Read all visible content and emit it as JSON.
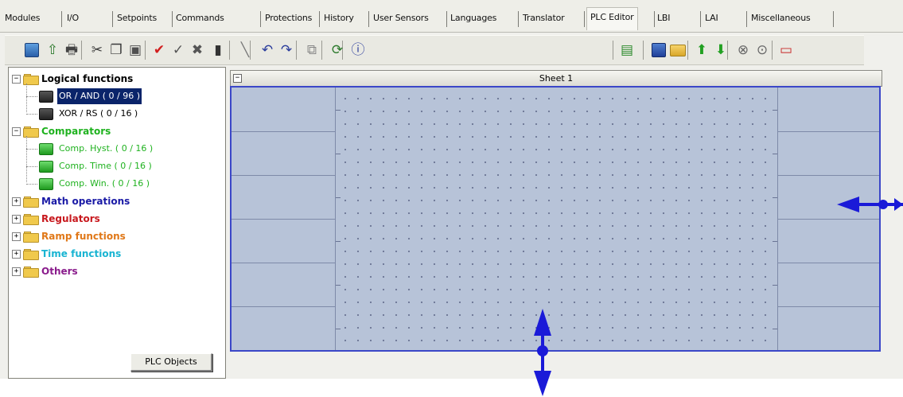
{
  "tabs": [
    {
      "label": "Modules",
      "active": false
    },
    {
      "label": "I/O",
      "active": false
    },
    {
      "label": "Setpoints",
      "active": false
    },
    {
      "label": "Commands",
      "active": false
    },
    {
      "label": "Protections",
      "active": false
    },
    {
      "label": "History",
      "active": false
    },
    {
      "label": "User Sensors",
      "active": false
    },
    {
      "label": "Languages",
      "active": false
    },
    {
      "label": "Translator",
      "active": false
    },
    {
      "label": "PLC Editor",
      "active": true
    },
    {
      "label": "LBI",
      "active": false
    },
    {
      "label": "LAI",
      "active": false
    },
    {
      "label": "Miscellaneous",
      "active": false
    }
  ],
  "toolbar": {
    "left_icons": [
      "save-icon",
      "upload-icon",
      "print-icon",
      "cut-icon",
      "copy-icon",
      "paste-icon",
      "check-red-icon",
      "check-icon",
      "delete-x-icon",
      "trash-icon",
      "line-tool-icon",
      "undo-icon",
      "redo-icon",
      "duplicate-icon",
      "refresh-doc-icon",
      "info-icon"
    ],
    "right_icons": [
      "new-sheet-icon",
      "save-disk-icon",
      "open-folder-icon",
      "move-up-icon",
      "move-down-icon",
      "collapse-all-icon",
      "expand-all-icon",
      "window-icon"
    ]
  },
  "tree": {
    "categories": [
      {
        "label": "Logical functions",
        "color": "#000000",
        "expanded": true,
        "items": [
          {
            "label": "OR / AND ( 0 / 96 )",
            "selected": true,
            "icon": "gray"
          },
          {
            "label": "XOR / RS ( 0 / 16 )",
            "selected": false,
            "icon": "gray"
          }
        ]
      },
      {
        "label": "Comparators",
        "color": "#1fb21f",
        "expanded": true,
        "items": [
          {
            "label": "Comp. Hyst. ( 0 / 16 )",
            "selected": false,
            "icon": "green"
          },
          {
            "label": "Comp. Time ( 0 / 16 )",
            "selected": false,
            "icon": "green"
          },
          {
            "label": "Comp. Win. ( 0 / 16 )",
            "selected": false,
            "icon": "green"
          }
        ]
      },
      {
        "label": "Math operations",
        "color": "#1a1aa6",
        "expanded": false,
        "items": []
      },
      {
        "label": "Regulators",
        "color": "#c8191e",
        "expanded": false,
        "items": []
      },
      {
        "label": "Ramp functions",
        "color": "#e07818",
        "expanded": false,
        "items": []
      },
      {
        "label": "Time functions",
        "color": "#19b4d2",
        "expanded": false,
        "items": []
      },
      {
        "label": "Others",
        "color": "#8a1c8c",
        "expanded": false,
        "items": []
      }
    ],
    "panel_button": "PLC Objects"
  },
  "sheet": {
    "title": "Sheet 1",
    "collapse_glyph": "−",
    "input_rows": 6,
    "output_rows": 6
  },
  "colors": {
    "arrow": "#1a1ad8",
    "sheet_border": "#3b47c8",
    "selection": "#0a246a"
  }
}
